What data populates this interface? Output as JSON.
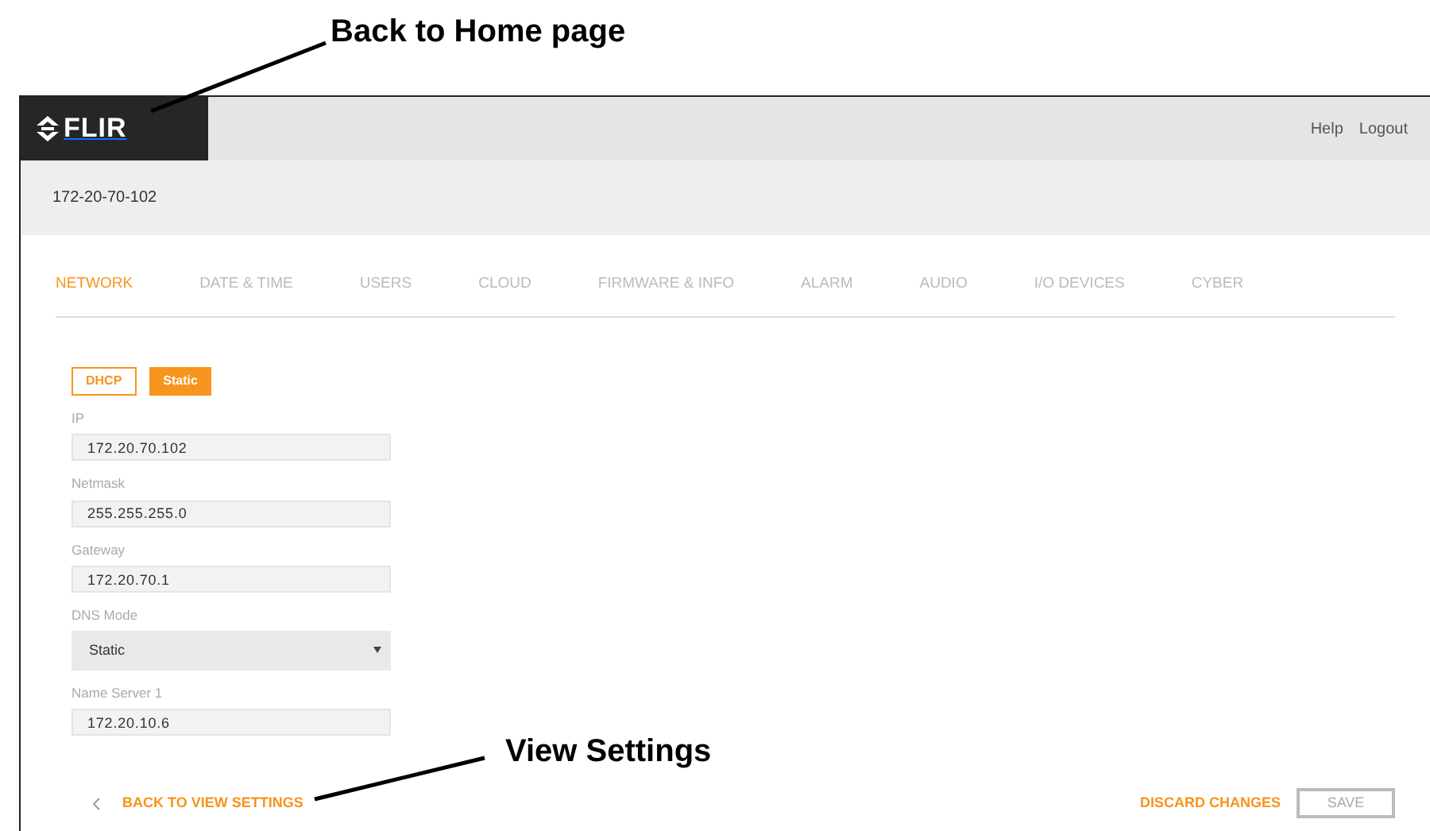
{
  "annotations": [
    {
      "text": "Back to Home page"
    },
    {
      "text": "View Settings"
    }
  ],
  "header": {
    "logo": "FLIR",
    "links": [
      "Help",
      "Logout"
    ]
  },
  "device_name": "172-20-70-102",
  "tabs": [
    {
      "label": "NETWORK",
      "selected": true
    },
    {
      "label": "DATE & TIME",
      "selected": false
    },
    {
      "label": "USERS",
      "selected": false
    },
    {
      "label": "CLOUD",
      "selected": false
    },
    {
      "label": "FIRMWARE & INFO",
      "selected": false
    },
    {
      "label": "ALARM",
      "selected": false
    },
    {
      "label": "AUDIO",
      "selected": false
    },
    {
      "label": "I/O DEVICES",
      "selected": false
    },
    {
      "label": "CYBER",
      "selected": false
    }
  ],
  "mode_buttons": [
    {
      "label": "DHCP",
      "selected": false
    },
    {
      "label": "Static",
      "selected": true
    }
  ],
  "fields": [
    {
      "kind": "text",
      "label": "IP",
      "value": "172.20.70.102"
    },
    {
      "kind": "text",
      "label": "Netmask",
      "value": "255.255.255.0"
    },
    {
      "kind": "text",
      "label": "Gateway",
      "value": "172.20.70.1"
    },
    {
      "kind": "select",
      "label": "DNS Mode",
      "value": "Static"
    },
    {
      "kind": "text",
      "label": "Name Server 1",
      "value": "172.20.10.6"
    }
  ],
  "footer": {
    "back_link": "BACK TO VIEW SETTINGS",
    "discard": "DISCARD CHANGES",
    "save": {
      "label": "SAVE",
      "disabled": true
    }
  }
}
